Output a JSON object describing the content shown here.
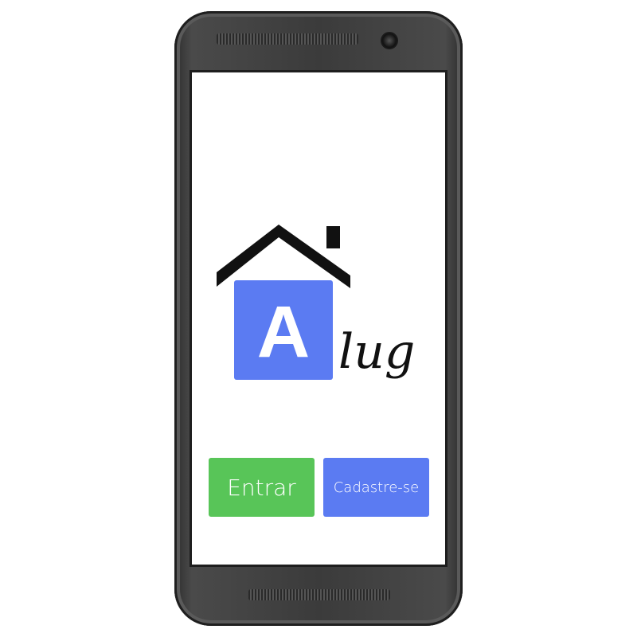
{
  "logo": {
    "letter": "A",
    "wordmark": "lug",
    "tile_color": "#5b7bf2",
    "roof_color": "#111111"
  },
  "buttons": {
    "entrar_label": "Entrar",
    "cadastre_label": "Cadastre-se",
    "entrar_color": "#58c558",
    "cadastre_color": "#5b7bf2"
  }
}
